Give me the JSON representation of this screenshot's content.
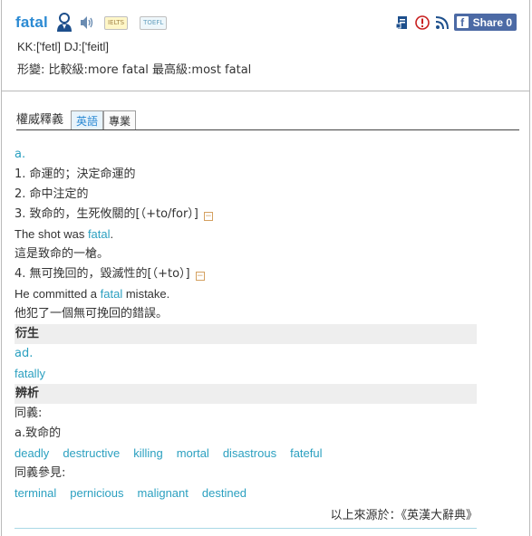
{
  "header": {
    "word": "fatal",
    "badges": [
      "IELTS",
      "TOEFL"
    ],
    "phonetic": "KK:['fetl] DJ:['feitl]",
    "forms": "形變: 比較級:more fatal  最高級:most fatal",
    "share_label": "Share 0",
    "icons": [
      "person-icon",
      "speaker-icon",
      "bookmark-icon",
      "report-icon",
      "rss-icon",
      "facebook-icon"
    ]
  },
  "tabs": {
    "title": "權威釋義",
    "items": [
      "英語",
      "專業"
    ],
    "active": "英語"
  },
  "entry": {
    "pos": "a.",
    "def1": "1. 命運的；決定命運的",
    "def2": "2. 命中注定的",
    "def3": "3. 致命的，生死攸關的[（+to/for）]",
    "ex3_pre": "The shot was ",
    "ex3_hl": "fatal",
    "ex3_post": ".",
    "ex3_zh": "這是致命的一槍。",
    "def4": "4. 無可挽回的，毀滅性的[（+to）]",
    "ex4_pre": "He committed a ",
    "ex4_hl": "fatal",
    "ex4_post": " mistake.",
    "ex4_zh": "他犯了一個無可挽回的錯誤。",
    "collapse_symbol": "−"
  },
  "derived": {
    "heading": "衍生",
    "pos": "ad.",
    "word": "fatally"
  },
  "analysis": {
    "heading": "辨析",
    "syn_label": "同義:",
    "syn_pos": "a.致命的",
    "synonyms": [
      "deadly",
      "destructive",
      "killing",
      "mortal",
      "disastrous",
      "fateful"
    ],
    "see_label": "同義參見:",
    "see_also": [
      "terminal",
      "pernicious",
      "malignant",
      "destined"
    ]
  },
  "source": "以上來源於：《英漢大辭典》"
}
